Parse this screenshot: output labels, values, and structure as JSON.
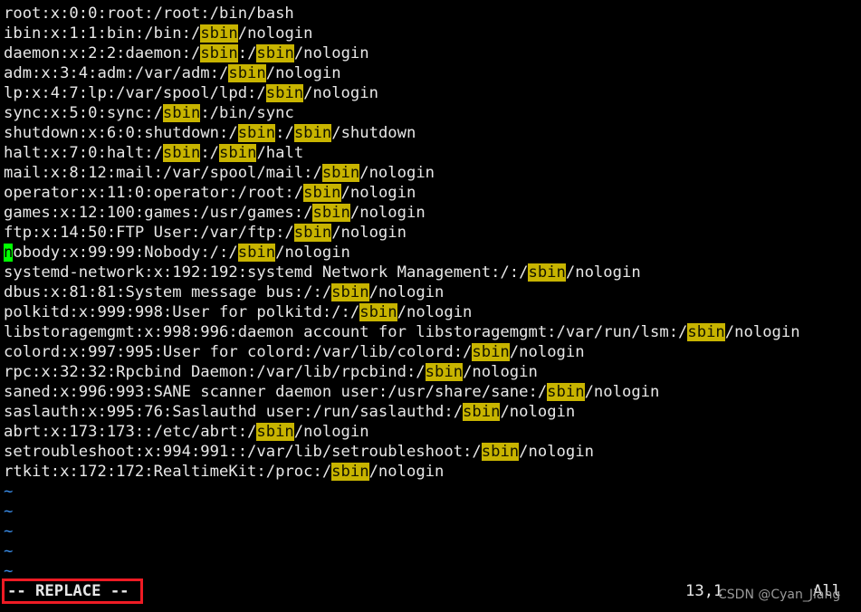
{
  "terminal": {
    "background_color": "#000000",
    "foreground_color": "#e8e8e8",
    "highlight_background_color": "#c8b400",
    "highlight_foreground_color": "#141400",
    "cursor_background_color": "#00ff00",
    "cursor_foreground_color": "#000000",
    "tilde_color": "#3b8eea",
    "annotation_color": "#ee1b24"
  },
  "editor": {
    "lines": [
      {
        "text": "root:x:0:0:root:/root:/bin/bash"
      },
      {
        "text": "ibin:x:1:1:bin:/bin:/sbin/nologin"
      },
      {
        "text": "daemon:x:2:2:daemon:/sbin:/sbin/nologin"
      },
      {
        "text": "adm:x:3:4:adm:/var/adm:/sbin/nologin"
      },
      {
        "text": "lp:x:4:7:lp:/var/spool/lpd:/sbin/nologin"
      },
      {
        "text": "sync:x:5:0:sync:/sbin:/bin/sync"
      },
      {
        "text": "shutdown:x:6:0:shutdown:/sbin:/sbin/shutdown"
      },
      {
        "text": "halt:x:7:0:halt:/sbin:/sbin/halt"
      },
      {
        "text": "mail:x:8:12:mail:/var/spool/mail:/sbin/nologin"
      },
      {
        "text": "operator:x:11:0:operator:/root:/sbin/nologin"
      },
      {
        "text": "games:x:12:100:games:/usr/games:/sbin/nologin"
      },
      {
        "text": "ftp:x:14:50:FTP User:/var/ftp:/sbin/nologin"
      },
      {
        "text": "nobody:x:99:99:Nobody:/:/sbin/nologin"
      },
      {
        "text": "systemd-network:x:192:192:systemd Network Management:/:/sbin/nologin"
      },
      {
        "text": "dbus:x:81:81:System message bus:/:/sbin/nologin"
      },
      {
        "text": "polkitd:x:999:998:User for polkitd:/:/sbin/nologin"
      },
      {
        "text": "libstoragemgmt:x:998:996:daemon account for libstoragemgmt:/var/run/lsm:/sbin/nologin"
      },
      {
        "text": "colord:x:997:995:User for colord:/var/lib/colord:/sbin/nologin"
      },
      {
        "text": "rpc:x:32:32:Rpcbind Daemon:/var/lib/rpcbind:/sbin/nologin"
      },
      {
        "text": "saned:x:996:993:SANE scanner daemon user:/usr/share/sane:/sbin/nologin"
      },
      {
        "text": "saslauth:x:995:76:Saslauthd user:/run/saslauthd:/sbin/nologin"
      },
      {
        "text": "abrt:x:173:173::/etc/abrt:/sbin/nologin"
      },
      {
        "text": "setroubleshoot:x:994:991::/var/lib/setroubleshoot:/sbin/nologin"
      },
      {
        "text": "rtkit:x:172:172:RealtimeKit:/proc:/sbin/nologin"
      }
    ],
    "empty_line_marker": "~",
    "empty_line_count": 5,
    "search_term": "sbin",
    "cursor": {
      "line_index": 12,
      "column_index": 0,
      "character": "n"
    }
  },
  "statusline": {
    "mode_label": "-- REPLACE --",
    "ruler": "13,1",
    "scroll_position": "All"
  },
  "watermark": {
    "text": "CSDN @Cyan_Jiang"
  }
}
